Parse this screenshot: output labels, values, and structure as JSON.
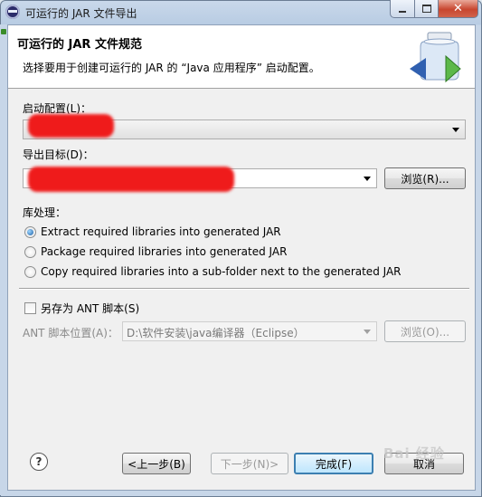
{
  "window": {
    "title": "可运行的 JAR 文件导出"
  },
  "banner": {
    "title": "可运行的 JAR 文件规范",
    "description": "选择要用于创建可运行的 JAR 的 “Java 应用程序” 启动配置。"
  },
  "launch_config": {
    "label": "启动配置(L)：",
    "value": ""
  },
  "export_dest": {
    "label": "导出目标(D)：",
    "value": "",
    "browse_label": "浏览(R)..."
  },
  "library_handling": {
    "label": "库处理：",
    "options": [
      {
        "label": "Extract required libraries into generated JAR",
        "selected": true
      },
      {
        "label": "Package required libraries into generated JAR",
        "selected": false
      },
      {
        "label": "Copy required libraries into a sub-folder next to the generated JAR",
        "selected": false
      }
    ]
  },
  "ant": {
    "checkbox_label": "另存为 ANT 脚本(S)",
    "checked": false,
    "location_label": "ANT 脚本位置(A)：",
    "location_value": "D:\\软件安装\\java编译器（Eclipse）",
    "browse_label": "浏览(O)..."
  },
  "footer": {
    "back_label": "<上一步(B)",
    "next_label": "下一步(N)>",
    "finish_label": "完成(F)",
    "cancel_label": "取消"
  },
  "watermark": "Bai 经验"
}
